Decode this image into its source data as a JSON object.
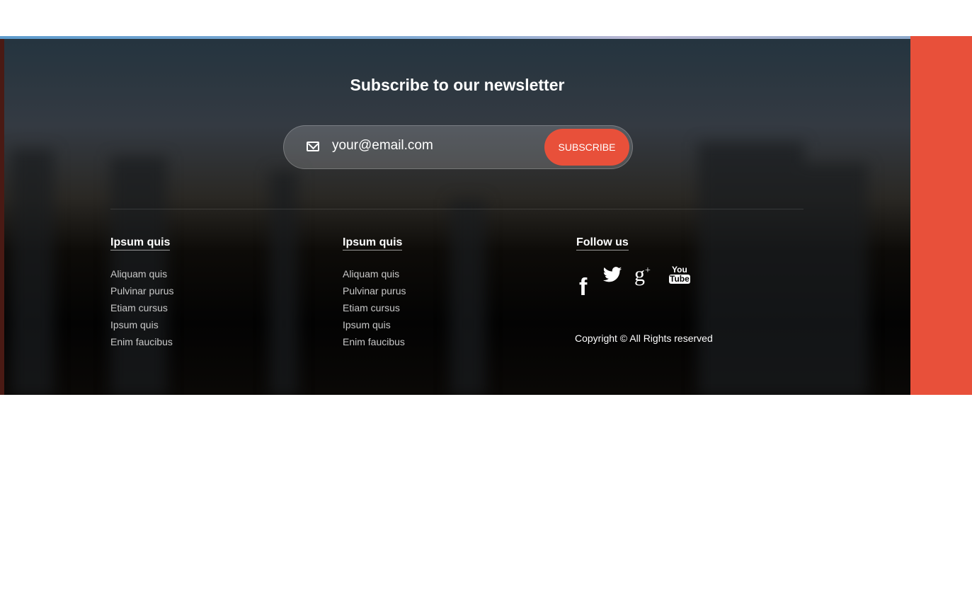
{
  "newsletter": {
    "title": "Subscribe to our newsletter",
    "email_value": "your@email.com",
    "subscribe_label": "SUBSCRIBE"
  },
  "columns": [
    {
      "heading": "Ipsum quis",
      "links": [
        "Aliquam quis",
        "Pulvinar purus",
        "Etiam cursus",
        "Ipsum quis",
        "Enim faucibus"
      ]
    },
    {
      "heading": "Ipsum quis",
      "links": [
        "Aliquam quis",
        "Pulvinar purus",
        "Etiam cursus",
        "Ipsum quis",
        "Enim faucibus"
      ]
    }
  ],
  "follow": {
    "heading": "Follow us",
    "icons": [
      "facebook-icon",
      "twitter-icon",
      "google-plus-icon",
      "youtube-icon"
    ]
  },
  "copyright": "Copyright © All Rights reserved",
  "colors": {
    "accent": "#e8503a"
  }
}
